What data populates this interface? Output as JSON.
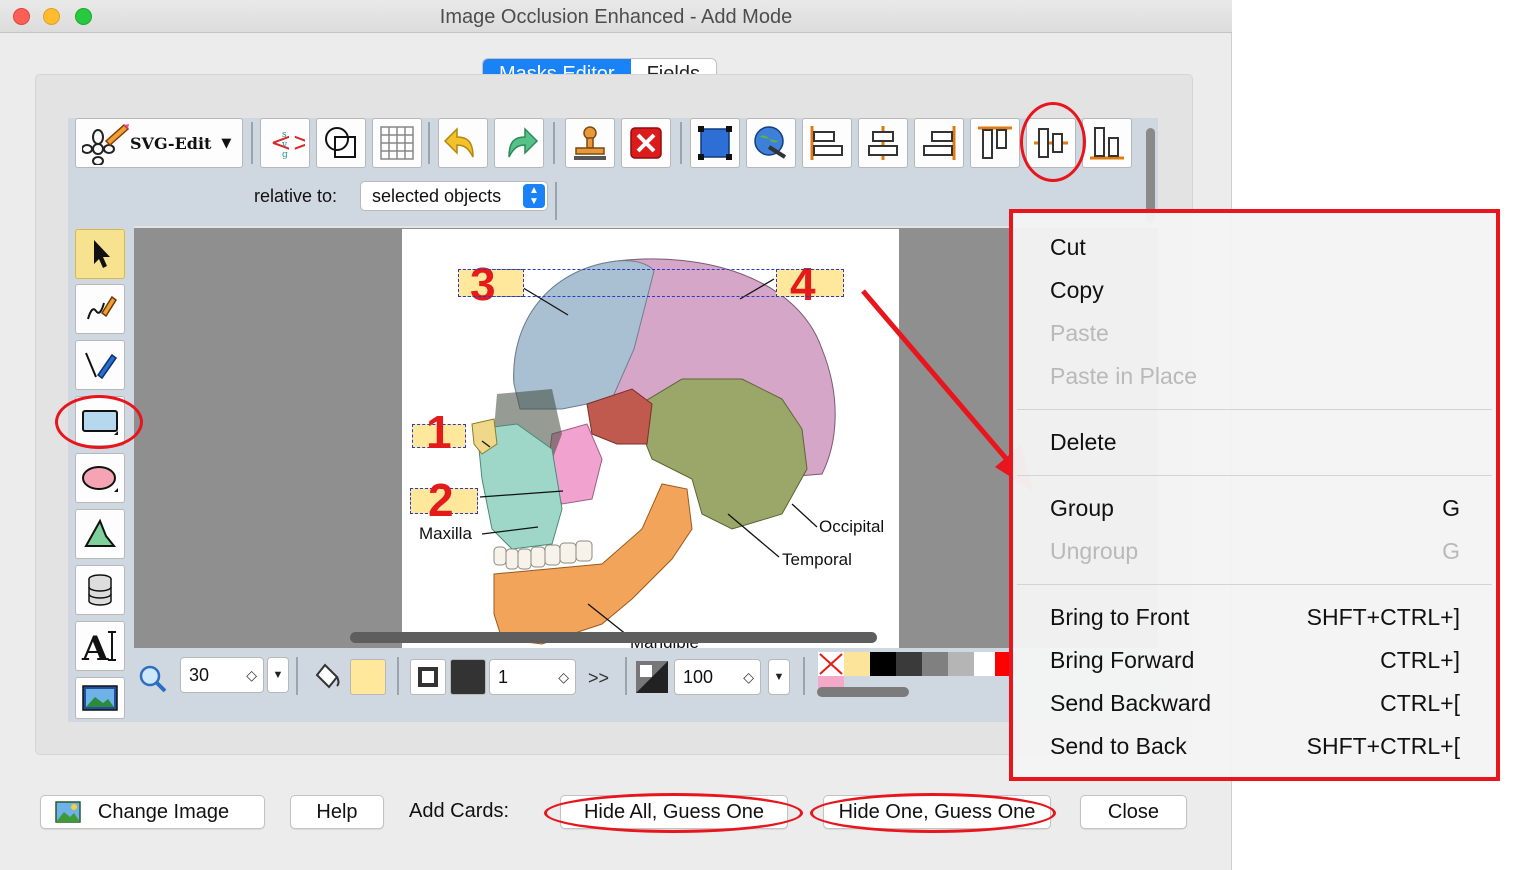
{
  "window": {
    "title": "Image Occlusion Enhanced - Add Mode"
  },
  "tabs": [
    {
      "label": "Masks Editor",
      "active": true
    },
    {
      "label": "Fields",
      "active": false
    }
  ],
  "toolbar": {
    "svgedit_label": "SVG-Edit",
    "buttons": [
      "svg-source-icon",
      "wireframe-icon",
      "grid-icon",
      "undo-icon",
      "redo-icon",
      "clone-icon",
      "delete-icon",
      "group-icon",
      "link-icon",
      "align-left-icon",
      "align-center-icon",
      "align-right-icon",
      "align-top-icon",
      "align-middle-icon",
      "align-bottom-icon"
    ],
    "relative_label": "relative to:",
    "relative_value": "selected objects"
  },
  "left_tools": [
    "select-icon",
    "pencil-icon",
    "pen-icon",
    "rectangle-icon",
    "ellipse-icon",
    "path-icon",
    "shapelib-icon",
    "text-icon",
    "image-icon"
  ],
  "canvas": {
    "labels": {
      "maxilla": "Maxilla",
      "occipital": "Occipital",
      "temporal": "Temporal",
      "mandible": "Mandible"
    },
    "mask_numbers": {
      "one": "1",
      "two": "2",
      "three": "3",
      "four": "4"
    }
  },
  "bottom_tools": {
    "zoom_value": "30",
    "stroke_width": "1",
    "more_label": ">>",
    "opacity_value": "100",
    "fill_color": "#ffe79b",
    "stroke_color": "#333333",
    "palette": [
      "#fde49b",
      "#000000",
      "#3a3a3a",
      "#808080",
      "#b5b5b5",
      "#ffffff",
      "#ff0000"
    ]
  },
  "buttons": {
    "change_image": "Change Image",
    "help": "Help",
    "add_cards_label": "Add Cards:",
    "hide_all": "Hide All, Guess One",
    "hide_one": "Hide One, Guess One",
    "close": "Close"
  },
  "context_menu": {
    "cut": "Cut",
    "copy": "Copy",
    "paste": "Paste",
    "paste_in_place": "Paste in Place",
    "delete": "Delete",
    "group": {
      "label": "Group",
      "shortcut": "G"
    },
    "ungroup": {
      "label": "Ungroup",
      "shortcut": "G"
    },
    "bring_to_front": {
      "label": "Bring to Front",
      "shortcut": "SHFT+CTRL+]"
    },
    "bring_forward": {
      "label": "Bring Forward",
      "shortcut": "CTRL+]"
    },
    "send_backward": {
      "label": "Send Backward",
      "shortcut": "CTRL+["
    },
    "send_to_back": {
      "label": "Send to Back",
      "shortcut": "SHFT+CTRL+["
    }
  },
  "colors": {
    "annotation_red": "#e8151c",
    "accent_blue": "#1a82f7",
    "mask_fill": "#ffe79b"
  }
}
